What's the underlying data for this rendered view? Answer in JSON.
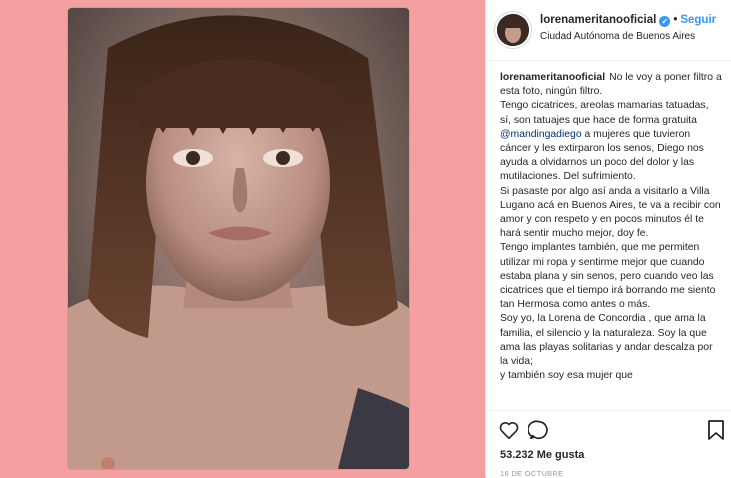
{
  "post": {
    "username": "lorenameritanooficial",
    "follow_label": "Seguir",
    "location": "Ciudad Autónoma de Buenos Aires",
    "caption": {
      "author": "lorenameritanooficial",
      "p1_a": "No le voy a poner filtro a esta foto, ningún filtro.",
      "p2_a": "Tengo cicatrices, areolas mamarias tatuadas, sí, son tatuajes que hace de forma gratuita ",
      "p2_mention": "@mandingadiego",
      "p2_b": " a mujeres que tuvieron cáncer y les extirparon los senos, Diego nos ayuda a olvidarnos un poco del dolor y las mutilaciones. Del sufrimiento.",
      "p3": "Si pasaste por algo así anda a visitarlo a Villa Lugano acá en Buenos Aires, te va a recibir con amor y con respeto y en pocos minutos él te hará sentir mucho mejor, doy fe.",
      "p4": "Tengo implantes también, que me permiten utilizar mi ropa y sentirme mejor que cuando estaba plana y sin senos, pero cuando veo las cicatrices que el tiempo irá borrando me siento tan Hermosa como antes o más.",
      "p5": "Soy yo, la Lorena de Concordia , que ama la familia, el silencio y la naturaleza. Soy la que ama las playas solitarias y andar descalza por la vida;",
      "p6": "y también soy esa mujer que"
    },
    "likes": "53.232 Me gusta",
    "date": "16 DE OCTUBRE"
  },
  "colors": {
    "background": "#f5a0a0",
    "link": "#3897f0",
    "mention": "#003569"
  },
  "icons": [
    "heart-icon",
    "comment-icon",
    "bookmark-icon",
    "verified-badge-icon"
  ]
}
